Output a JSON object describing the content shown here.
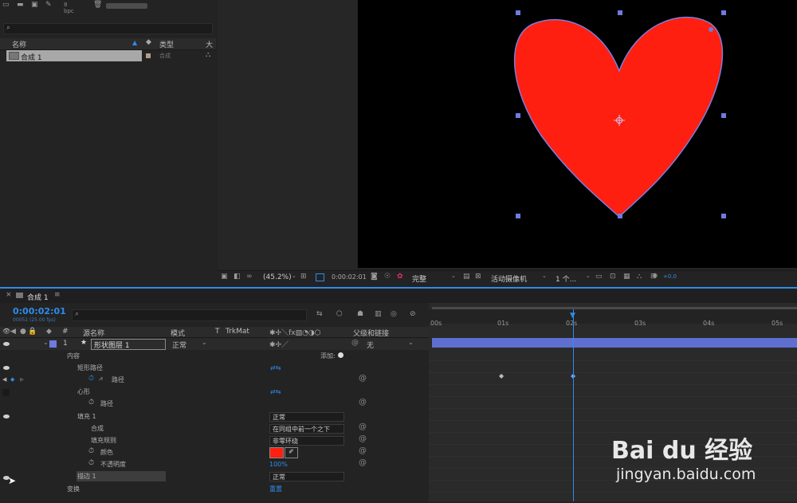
{
  "colors": {
    "accent": "#2d8ceb",
    "heart": "#ff1f10",
    "layer_bar": "#5f6fcf",
    "selection": "#a8a8a8"
  },
  "project": {
    "columns": {
      "name": "名称",
      "type": "类型",
      "size": "大"
    },
    "item": {
      "name": "合成 1",
      "type": "合成"
    },
    "bpc": "8 bpc"
  },
  "viewer_toolbar": {
    "zoom": "(45.2%)",
    "timecode": "0:00:02:01",
    "resolution": "完整",
    "camera": "活动摄像机",
    "views": "1 个...",
    "exposure": "+0.0"
  },
  "timeline": {
    "tab": "合成 1",
    "timecode": "0:00:02:01",
    "fps": "00051 (25.00 fps)",
    "columns": {
      "hash": "#",
      "source_name": "源名称",
      "mode": "模式",
      "t": "T",
      "trkmat": "TrkMat",
      "parent": "父级和链接"
    },
    "layer": {
      "number": "1",
      "name": "形状图层 1",
      "mode": "正常",
      "parent": "无"
    },
    "props": {
      "contents": "内容",
      "add": "添加:",
      "rect_path": "矩形路径",
      "path1": "路径",
      "heart": "心形",
      "path2": "路径",
      "fill": "填充 1",
      "fill_mode": "正常",
      "composite": "合成",
      "composite_val": "在同组中前一个之下",
      "fill_rule": "填充规则",
      "fill_rule_val": "非零环绕",
      "color": "颜色",
      "opacity": "不透明度",
      "opacity_val": "100%",
      "stroke": "描边 1",
      "stroke_mode": "正常",
      "transform": "变换",
      "reset": "重置"
    },
    "ruler_ticks": [
      "00s",
      "01s",
      "02s",
      "03s",
      "04s",
      "05s"
    ]
  },
  "watermark": {
    "brand": "Bai du 经验",
    "url": "jingyan.baidu.com"
  }
}
